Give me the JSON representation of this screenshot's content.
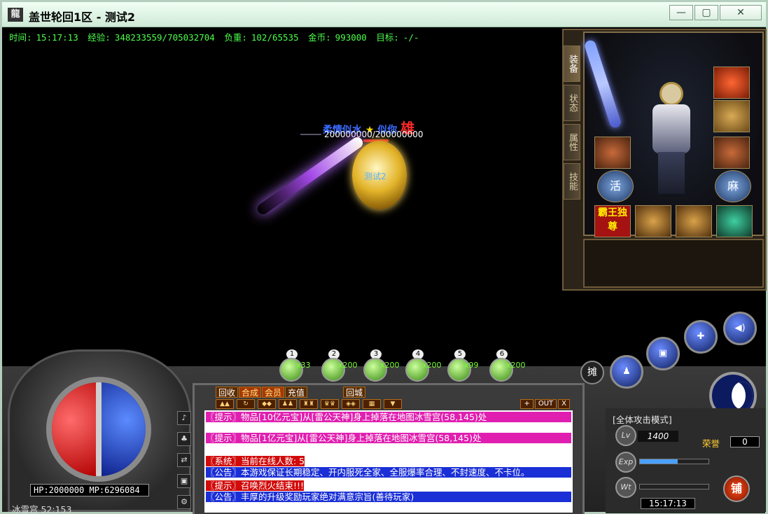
{
  "window": {
    "title": "盖世轮回1区 - 测试2",
    "icon_name": "app-logo-icon",
    "buttons": [
      "minimize",
      "maximize",
      "close"
    ]
  },
  "status": {
    "time_label": "时间:",
    "time": "15:17:13",
    "exp_label": "经验:",
    "exp": "348233559/705032704",
    "weight_label": "负重:",
    "weight": "102/65535",
    "gold_label": "金币:",
    "gold": "993000",
    "target_label": "目标:",
    "target": "-/-"
  },
  "scene": {
    "player_name": "测试2",
    "npc_title": "柔情似水",
    "npc_title2": "似你",
    "npc_guild": "雄",
    "npc_hp": "200000000/200000000"
  },
  "equipment": {
    "tabs": [
      "装备",
      "状态",
      "属性",
      "技能"
    ],
    "active_tab": "装备",
    "slot_labels": {
      "left_ring": "活",
      "right_ring": "麻",
      "badge": "霸王独尊"
    }
  },
  "hud": {
    "hp_mp": "HP:2000000 MP:6296084",
    "location": "冰雪宫 52:153",
    "attack_mode": "[全体攻击模式]",
    "level": "1400",
    "level_label": "Lv",
    "exp_label": "Exp",
    "weight_label": "Wt",
    "honor_label": "荣誉",
    "honor": "0",
    "clock": "15:17:13",
    "shop": "铺",
    "stall": "摊",
    "exp_fill_pct": 55
  },
  "quickbar": [
    {
      "num": "1",
      "count": "x33"
    },
    {
      "num": "2",
      "count": "x200"
    },
    {
      "num": "3",
      "count": "x200"
    },
    {
      "num": "4",
      "count": "x200"
    },
    {
      "num": "5",
      "count": "x99"
    },
    {
      "num": "6",
      "count": "x200"
    }
  ],
  "chat": {
    "tabs": [
      "回收",
      "合成",
      "会员",
      "充值",
      "回城"
    ],
    "controls": [
      "+",
      "OUT",
      "X"
    ],
    "messages": [
      {
        "style": "pink",
        "text": "〖提示〗物品[10亿元宝]从[雷公天神]身上掉落在地图冰雪宫(58,145)处"
      },
      {
        "style": "pink",
        "text": "〖提示〗物品[1亿元宝]从[雷公天神]身上掉落在地图冰雪宫(58,145)处"
      },
      {
        "style": "red",
        "text": "〖系统〗当前在线人数: 5"
      },
      {
        "style": "blue",
        "text": "〖公告〗本游戏保证长期稳定、开内服死全家、全服爆率合理、不封速度、不卡位。"
      },
      {
        "style": "red",
        "text": "〖提示〗召唤烈火结束!!!"
      },
      {
        "style": "blue",
        "text": "〖公告〗丰厚的升级奖励玩家绝对满意宗旨(善待玩家)"
      }
    ]
  }
}
